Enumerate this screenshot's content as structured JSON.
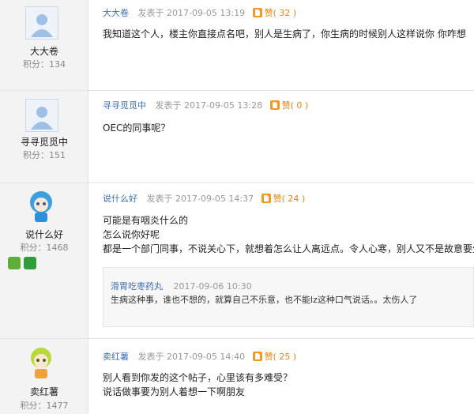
{
  "score_label": "积分：",
  "posted_prefix": "发表于",
  "like_label": "赞",
  "posts": [
    {
      "username": "大大卷",
      "score": "134",
      "author": "大大卷",
      "time": "2017-09-05 13:19",
      "likes": "( 32 )",
      "lines": [
        "我知道这个人，楼主你直接点名吧，别人是生病了，你生病的时候别人这样说你 你咋想"
      ]
    },
    {
      "username": "寻寻觅觅中",
      "score": "151",
      "author": "寻寻觅觅中",
      "time": "2017-09-05 13:28",
      "likes": "( 0 )",
      "lines": [
        "OEC的同事呢？"
      ]
    },
    {
      "username": "说什么好",
      "score": "1468",
      "author": "说什么好",
      "time": "2017-09-05 14:37",
      "likes": "( 24 )",
      "lines": [
        "可能是有咽炎什么的",
        "怎么说你好呢",
        "都是一个部门同事，不说关心下，就想着怎么让人离远点。令人心寒，别人又不是故意要生病"
      ],
      "reply": {
        "author": "滑胃吃枣药丸",
        "time": "2017-09-06 10:30",
        "text": "生病这种事，谁也不想的，就算自己不乐意，也不能lz这种口气说话。。太伤人了"
      }
    },
    {
      "username": "卖红薯",
      "score": "1477",
      "author": "卖红薯",
      "time": "2017-09-05 14:40",
      "likes": "( 25 )",
      "lines": [
        "别人看到你发的这个帖子，心里该有多难受？",
        "说话做事要为别人着想一下啊朋友"
      ]
    }
  ],
  "colors": {
    "link": "#3a6fb0",
    "like": "#e8850c",
    "sidebar": "#f3f3f3"
  }
}
